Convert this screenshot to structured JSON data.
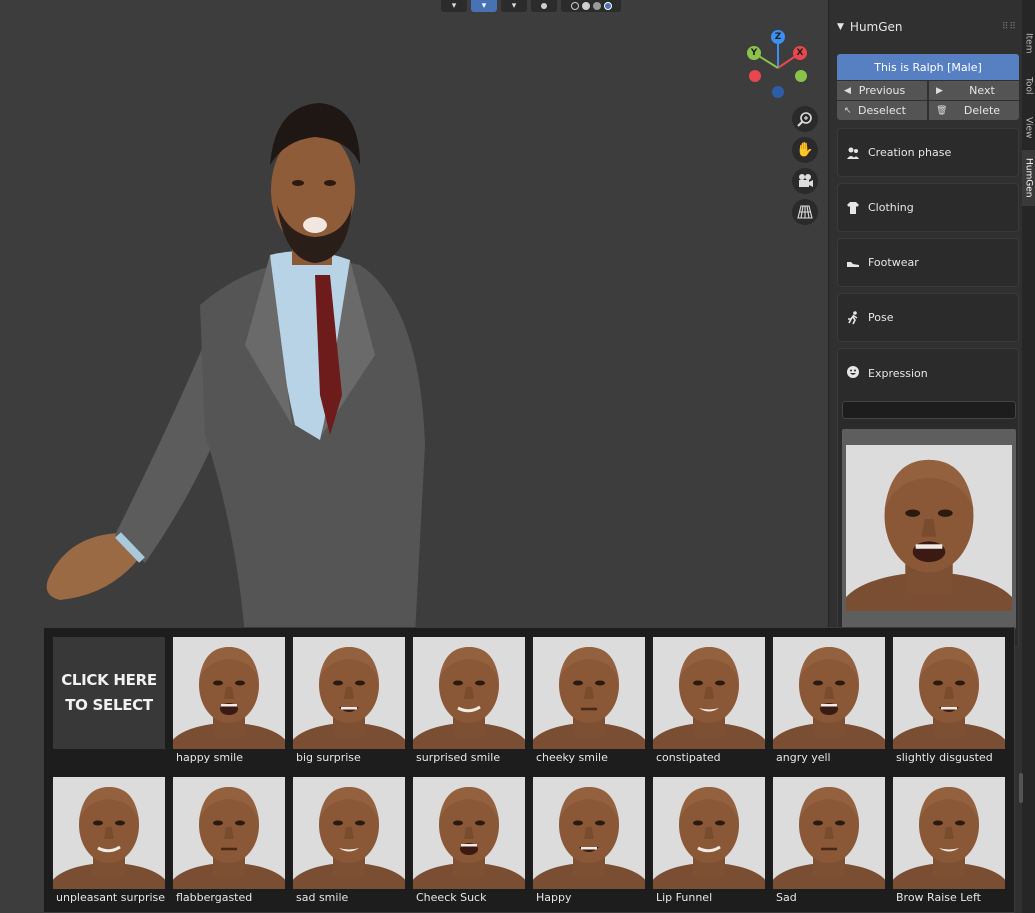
{
  "panel": {
    "title": "HumGen",
    "character_button": "This is Ralph [Male]",
    "previous_label": "Previous",
    "next_label": "Next",
    "deselect_label": "Deselect",
    "delete_label": "Delete",
    "sections": [
      {
        "label": "Creation phase",
        "icon": "people-icon"
      },
      {
        "label": "Clothing",
        "icon": "shirt-icon"
      },
      {
        "label": "Footwear",
        "icon": "shoe-icon"
      },
      {
        "label": "Pose",
        "icon": "running-icon"
      }
    ],
    "expression_label": "Expression",
    "search_value": ""
  },
  "sidebar_tabs": [
    "Item",
    "Tool",
    "View",
    "HumGen"
  ],
  "gizmo": {
    "x": "X",
    "y": "Y",
    "z": "Z"
  },
  "popup": {
    "select_label_line1": "CLICK HERE",
    "select_label_line2": "TO SELECT",
    "row1": [
      "happy smile",
      "big surprise",
      "surprised smile",
      "cheeky smile",
      "constipated",
      "angry yell",
      "slightly disgusted"
    ],
    "row2": [
      "unpleasant surprise",
      "flabbergasted",
      "sad smile",
      "Cheeck Suck",
      "Happy",
      "Lip Funnel",
      "Sad",
      "Brow Raise Left"
    ]
  },
  "colors": {
    "accent": "#5680c2",
    "viewport_bg": "#3d3d3d",
    "axis_x": "#e8474e",
    "axis_y": "#8bc34a",
    "axis_z": "#3d8ff5"
  }
}
